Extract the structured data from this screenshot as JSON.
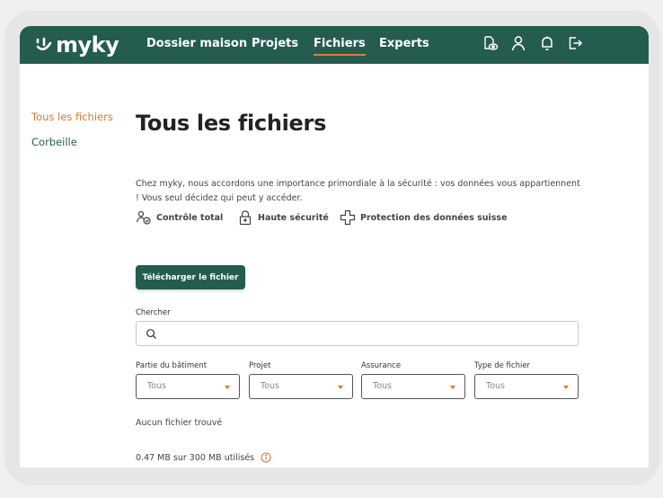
{
  "brand": {
    "name": "myky"
  },
  "nav": {
    "links": [
      "Dossier maison",
      "Projets",
      "Fichiers",
      "Experts"
    ],
    "active": "Fichiers",
    "icons": [
      "dossier-eye-icon",
      "user-icon",
      "bell-icon",
      "logout-icon"
    ]
  },
  "sidebar": {
    "items": [
      {
        "label": "Tous les fichiers",
        "active": true
      },
      {
        "label": "Corbeille",
        "active": false
      }
    ]
  },
  "main": {
    "title": "Tous les fichiers",
    "intro": "Chez myky, nous accordons une importance primordiale à la sécurité : vos données vous appartiennent ! Vous seul décidez qui peut y accéder.",
    "features": [
      "Contrôle total",
      "Haute sécurité",
      "Protection des données suisse"
    ],
    "upload_button": "Télécharger le fichier",
    "search": {
      "label": "Chercher",
      "value": "",
      "placeholder": ""
    },
    "filters": [
      {
        "label": "Partie du bâtiment",
        "value": "Tous"
      },
      {
        "label": "Projet",
        "value": "Tous"
      },
      {
        "label": "Assurance",
        "value": "Tous"
      },
      {
        "label": "Type de fichier",
        "value": "Tous"
      }
    ],
    "empty_message": "Aucun fichier trouvé",
    "storage_usage": "0.47 MB sur 300 MB utilisés"
  },
  "colors": {
    "brand_green": "#245c4f",
    "accent_orange": "#d9772f"
  }
}
